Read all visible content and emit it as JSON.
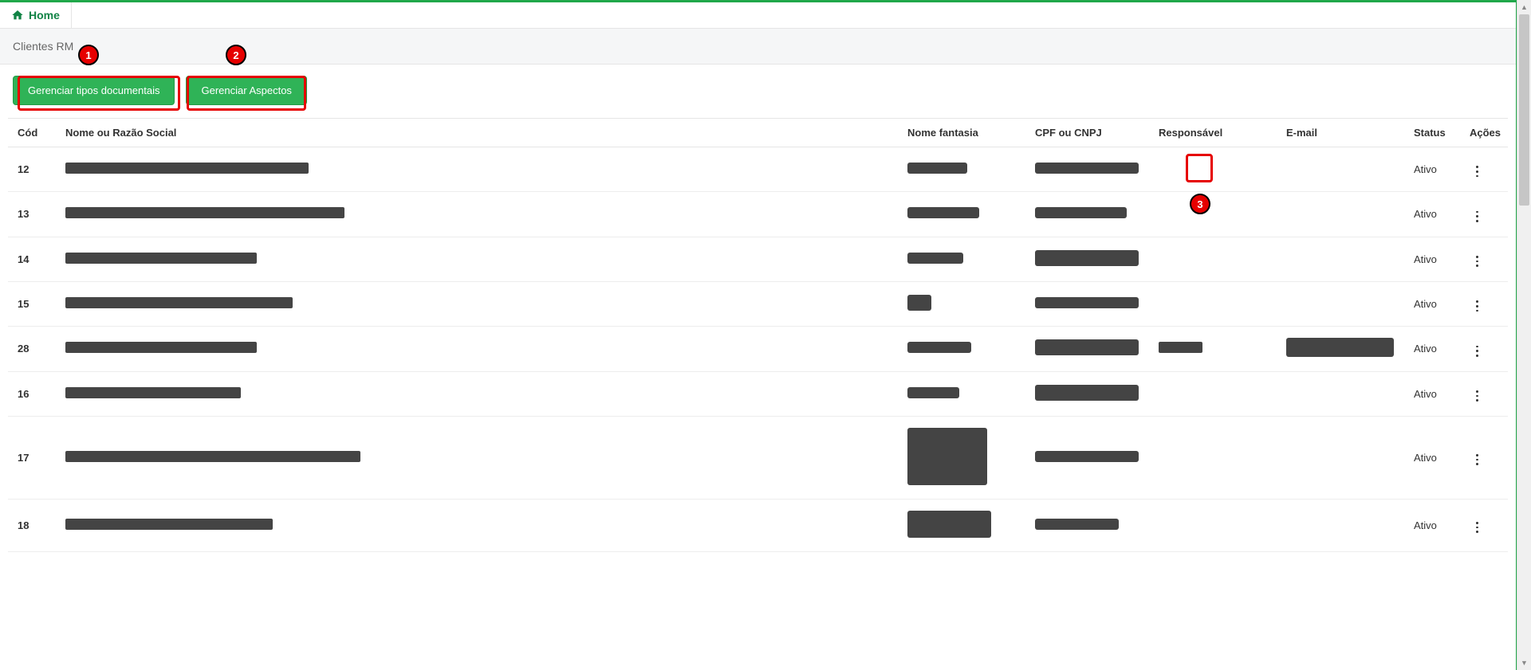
{
  "breadcrumb": {
    "home_label": "Home"
  },
  "page": {
    "title": "Clientes RM"
  },
  "toolbar": {
    "manage_doc_types": "Gerenciar tipos documentais",
    "manage_aspects": "Gerenciar Aspectos"
  },
  "table": {
    "headers": {
      "cod": "Cód",
      "nome": "Nome ou Razão Social",
      "fantasia": "Nome fantasia",
      "cpf": "CPF ou CNPJ",
      "resp": "Responsável",
      "email": "E-mail",
      "status": "Status",
      "acoes": "Ações"
    },
    "rows": [
      {
        "cod": "12",
        "nome_w": 305,
        "fantasia_w": 75,
        "fantasia_h": 14,
        "cpf_w": 130,
        "cpf_h": 14,
        "resp": false,
        "email": false,
        "status": "Ativo"
      },
      {
        "cod": "13",
        "nome_w": 350,
        "fantasia_w": 90,
        "fantasia_h": 14,
        "cpf_w": 115,
        "cpf_h": 14,
        "resp": false,
        "email": false,
        "status": "Ativo"
      },
      {
        "cod": "14",
        "nome_w": 240,
        "fantasia_w": 70,
        "fantasia_h": 14,
        "cpf_w": 130,
        "cpf_h": 20,
        "resp": false,
        "email": false,
        "status": "Ativo"
      },
      {
        "cod": "15",
        "nome_w": 285,
        "fantasia_w": 30,
        "fantasia_h": 20,
        "cpf_w": 130,
        "cpf_h": 14,
        "resp": false,
        "email": false,
        "status": "Ativo"
      },
      {
        "cod": "28",
        "nome_w": 240,
        "fantasia_w": 80,
        "fantasia_h": 14,
        "cpf_w": 130,
        "cpf_h": 20,
        "resp": true,
        "resp_w": 55,
        "email": true,
        "email_w": 135,
        "email_h": 24,
        "status": "Ativo"
      },
      {
        "cod": "16",
        "nome_w": 220,
        "fantasia_w": 65,
        "fantasia_h": 14,
        "cpf_w": 130,
        "cpf_h": 20,
        "resp": false,
        "email": false,
        "status": "Ativo"
      },
      {
        "cod": "17",
        "nome_w": 370,
        "fantasia_w": 100,
        "fantasia_h": 72,
        "cpf_w": 130,
        "cpf_h": 14,
        "resp": false,
        "email": false,
        "status": "Ativo"
      },
      {
        "cod": "18",
        "nome_w": 260,
        "fantasia_w": 105,
        "fantasia_h": 34,
        "cpf_w": 105,
        "cpf_h": 14,
        "resp": false,
        "email": false,
        "status": "Ativo"
      }
    ]
  },
  "annotations": {
    "a1": "1",
    "a2": "2",
    "a3": "3"
  }
}
